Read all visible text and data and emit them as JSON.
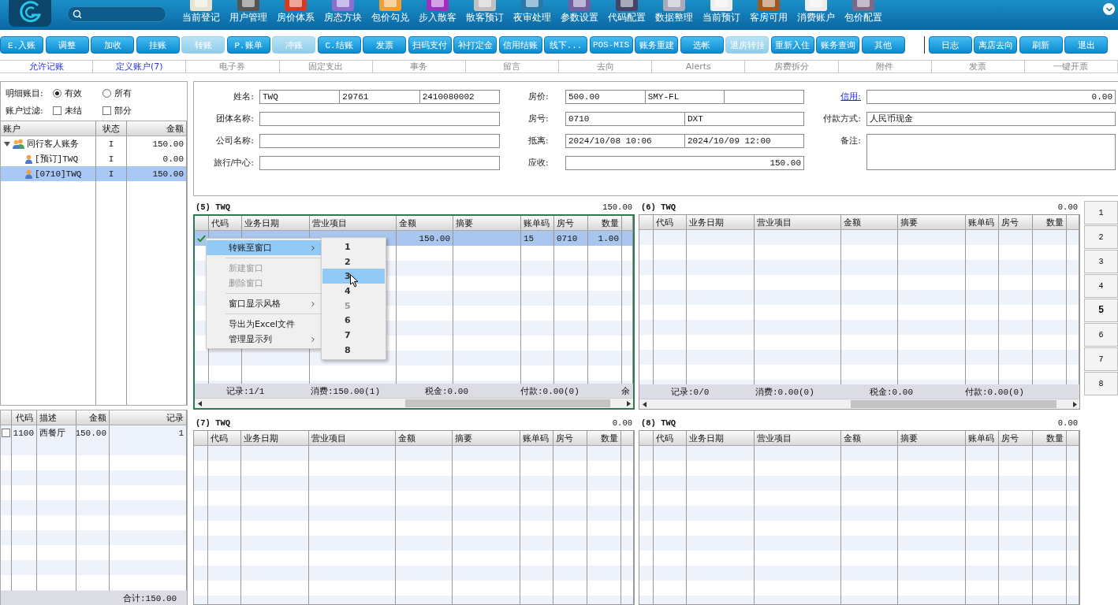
{
  "nav_items": [
    "当前登记",
    "用户管理",
    "房价体系",
    "房态方块",
    "包价勾兑",
    "步入散客",
    "散客预订",
    "夜审处理",
    "参数设置",
    "代码配置",
    "数据整理",
    "当前预订",
    "客房可用",
    "消费账户",
    "包价配置"
  ],
  "actions": [
    {
      "label": "E.入账",
      "disabled": false
    },
    {
      "label": "调整",
      "disabled": false
    },
    {
      "label": "加收",
      "disabled": false
    },
    {
      "label": "挂账",
      "disabled": false
    },
    {
      "label": "转账",
      "disabled": true
    },
    {
      "label": "P.账单",
      "disabled": false
    },
    {
      "label": "冲账",
      "disabled": true
    },
    {
      "label": "C.结账",
      "disabled": false
    },
    {
      "label": "发票",
      "disabled": false
    },
    {
      "label": "扫码支付",
      "disabled": false
    },
    {
      "label": "补打定金",
      "disabled": false
    },
    {
      "label": "信用结账",
      "disabled": false
    },
    {
      "label": "线下...",
      "disabled": false
    },
    {
      "label": "POS-MIS",
      "disabled": false
    },
    {
      "label": "账务重建",
      "disabled": false
    },
    {
      "label": "选帐",
      "disabled": false
    },
    {
      "label": "退房转挂",
      "disabled": true
    },
    {
      "label": "重新入住",
      "disabled": false
    },
    {
      "label": "账务查询",
      "disabled": false
    },
    {
      "label": "其他",
      "disabled": false
    }
  ],
  "side_actions": [
    {
      "label": "日志",
      "disabled": false
    },
    {
      "label": "离店去向",
      "disabled": false
    },
    {
      "label": "刷新",
      "disabled": false
    },
    {
      "label": "退出",
      "disabled": false
    }
  ],
  "tabs": [
    {
      "label": "允许记账",
      "selected": true
    },
    {
      "label": "定义账户(7)",
      "selected": true
    },
    {
      "label": "电子券",
      "selected": false
    },
    {
      "label": "固定支出",
      "selected": false
    },
    {
      "label": "事务",
      "selected": false
    },
    {
      "label": "留言",
      "selected": false
    },
    {
      "label": "去向",
      "selected": false
    },
    {
      "label": "Alerts",
      "selected": false
    },
    {
      "label": "房费拆分",
      "selected": false
    },
    {
      "label": "附件",
      "selected": false
    },
    {
      "label": "发票",
      "selected": false
    },
    {
      "label": "一键开票",
      "selected": false
    }
  ],
  "filters": {
    "detail_label": "明细账目:",
    "detail_options": [
      {
        "label": "有效",
        "selected": true
      },
      {
        "label": "所有",
        "selected": false
      }
    ],
    "filter_label": "账户过滤:",
    "filter_options": [
      {
        "label": "未结",
        "checked": false
      },
      {
        "label": "部分",
        "checked": false
      }
    ]
  },
  "accounts": {
    "columns": [
      "账户",
      "状态",
      "金额"
    ],
    "tree": [
      {
        "name": "同行客人账务",
        "kind": "group",
        "status": "I",
        "amount": "150.00",
        "expanded": true,
        "selected": false,
        "children": [
          {
            "name": "[预订]TWQ",
            "kind": "person",
            "status": "I",
            "amount": "0.00",
            "selected": false
          },
          {
            "name": "[0710]TWQ",
            "kind": "person",
            "status": "I",
            "amount": "150.00",
            "selected": true
          }
        ]
      }
    ]
  },
  "charges": {
    "columns": [
      "代码",
      "描述",
      "金额",
      "记录"
    ],
    "rows": [
      {
        "checked": false,
        "cells": [
          "1100",
          "西餐厅",
          "150.00",
          "1"
        ]
      }
    ],
    "total": "合计:150.00"
  },
  "form": {
    "columns": [
      {
        "fields": [
          {
            "label": "姓名:",
            "kind": "triple",
            "link": false,
            "values": [
              "TWQ",
              "29761",
              "2410080002"
            ]
          },
          {
            "label": "团体名称:",
            "kind": "single",
            "link": false
          },
          {
            "label": "公司名称:",
            "kind": "single",
            "link": false
          },
          {
            "label": "旅行/中心:",
            "kind": "single",
            "link": false
          }
        ]
      },
      {
        "fields": [
          {
            "label": "房价:",
            "kind": "triple",
            "link": false,
            "values": [
              "500.00",
              "SMY-FL"
            ]
          },
          {
            "label": "房号:",
            "kind": "double",
            "link": false,
            "values": [
              "0710",
              "DXT"
            ]
          },
          {
            "label": "抵离:",
            "kind": "double",
            "link": false,
            "values": [
              "2024/10/08 10:06",
              "2024/10/09 12:00"
            ]
          },
          {
            "label": "应收:",
            "kind": "amount",
            "link": false,
            "values": [
              "150.00"
            ]
          }
        ]
      },
      {
        "fields": [
          {
            "label": "信用:",
            "kind": "amount",
            "link": true,
            "values": [
              "0.00"
            ]
          },
          {
            "label": "付款方式:",
            "kind": "single",
            "link": false,
            "values": [
              "人民币现金"
            ]
          },
          {
            "label": "备注:",
            "kind": "memo",
            "link": false
          }
        ]
      }
    ]
  },
  "windows": [
    {
      "title": "(5) TWQ",
      "total": "150.00",
      "active": true,
      "columns": [
        "代码",
        "业务日期",
        "营业项目",
        "金额",
        "摘要",
        "账单码",
        "房号",
        "数量"
      ],
      "rows": [
        {
          "checked": true,
          "selected": true,
          "amount": "150.00",
          "bill_code": "15",
          "room": "0710",
          "quantity": "1.00"
        }
      ],
      "summary": [
        "记录:1/1",
        "消费:150.00(1)",
        "税金:0.00",
        "付款:0.00(0)",
        "余"
      ]
    },
    {
      "title": "(6) TWQ",
      "total": "0.00",
      "active": false,
      "columns": [
        "代码",
        "业务日期",
        "营业项目",
        "金额",
        "摘要",
        "账单码",
        "房号",
        "数量"
      ],
      "summary": [
        "记录:0/0",
        "消费:0.00(0)",
        "税金:0.00",
        "付款:0.00(0)"
      ]
    },
    {
      "title": "(7) TWQ",
      "total": "0.00",
      "active": false,
      "columns": [
        "代码",
        "业务日期",
        "营业项目",
        "金额",
        "摘要",
        "账单码",
        "房号",
        "数量"
      ]
    },
    {
      "title": "(8) TWQ",
      "total": "0.00",
      "active": false,
      "columns": [
        "代码",
        "业务日期",
        "营业项目",
        "金额",
        "摘要",
        "账单码",
        "房号",
        "数量"
      ]
    }
  ],
  "window_switcher": [
    {
      "label": "1",
      "selected": false
    },
    {
      "label": "2",
      "selected": false
    },
    {
      "label": "3",
      "selected": false
    },
    {
      "label": "4",
      "selected": false
    },
    {
      "label": "5",
      "selected": true
    },
    {
      "label": "6",
      "selected": false
    },
    {
      "label": "7",
      "selected": false
    },
    {
      "label": "8",
      "selected": false
    }
  ],
  "context_menu": {
    "items": [
      {
        "label": "转账至窗口",
        "kind": "submenu",
        "disabled": false,
        "highlighted": true
      },
      {
        "kind": "separator"
      },
      {
        "label": "新建窗口",
        "kind": "action",
        "disabled": true,
        "highlighted": false
      },
      {
        "label": "删除窗口",
        "kind": "action",
        "disabled": true,
        "highlighted": false
      },
      {
        "kind": "separator"
      },
      {
        "label": "窗口显示风格",
        "kind": "submenu",
        "disabled": false,
        "highlighted": false
      },
      {
        "kind": "separator"
      },
      {
        "label": "导出为Excel文件",
        "kind": "action",
        "disabled": false,
        "highlighted": false
      },
      {
        "label": "管理显示列",
        "kind": "submenu",
        "disabled": false,
        "highlighted": false
      }
    ],
    "submenu": [
      {
        "label": "1",
        "disabled": false,
        "highlighted": false
      },
      {
        "label": "2",
        "disabled": false,
        "highlighted": false
      },
      {
        "label": "3",
        "disabled": false,
        "highlighted": true
      },
      {
        "label": "4",
        "disabled": false,
        "highlighted": false
      },
      {
        "label": "5",
        "disabled": true,
        "highlighted": false
      },
      {
        "label": "6",
        "disabled": false,
        "highlighted": false
      },
      {
        "label": "7",
        "disabled": false,
        "highlighted": false
      },
      {
        "label": "8",
        "disabled": false,
        "highlighted": false
      }
    ]
  }
}
